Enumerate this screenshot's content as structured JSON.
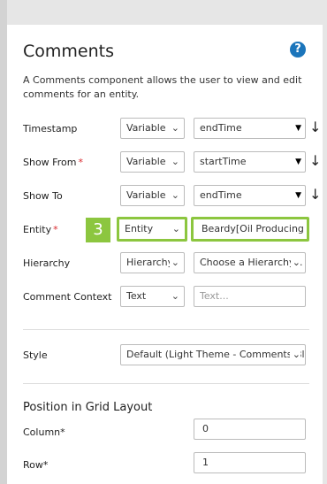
{
  "panel": {
    "title": "Comments",
    "help_icon": "?",
    "description": "A Comments component allows the user to view and edit comments for an entity."
  },
  "rows": {
    "timestamp": {
      "label": "Timestamp",
      "type": "Variable",
      "value": "endTime",
      "required": false
    },
    "show_from": {
      "label": "Show From",
      "required_mark": "*",
      "type": "Variable",
      "value": "startTime"
    },
    "show_to": {
      "label": "Show To",
      "type": "Variable",
      "value": "endTime"
    },
    "entity": {
      "label": "Entity",
      "required_mark": "*",
      "type": "Entity",
      "value": "Beardy[Oil Producing \\"
    },
    "hierarchy": {
      "label": "Hierarchy",
      "type": "Hierarchy",
      "value": "Choose a Hierarchy..."
    },
    "comment_context": {
      "label": "Comment Context",
      "type": "Text",
      "placeholder": "Text..."
    }
  },
  "step_badge": "3",
  "style": {
    "label": "Style",
    "value": "Default (Light Theme - Comments Blo"
  },
  "grid_layout": {
    "section_title": "Position in Grid Layout",
    "column_label": "Column*",
    "column_value": "0",
    "row_label": "Row*",
    "row_value": "1"
  },
  "icons": {
    "chevron": "chevron-down-icon",
    "dropdown_triangle": "triangle-down-icon",
    "sort_arrow": "arrow-down-icon"
  },
  "colors": {
    "highlight": "#8cc63f",
    "help": "#1b75bb",
    "required": "#d9292e"
  }
}
